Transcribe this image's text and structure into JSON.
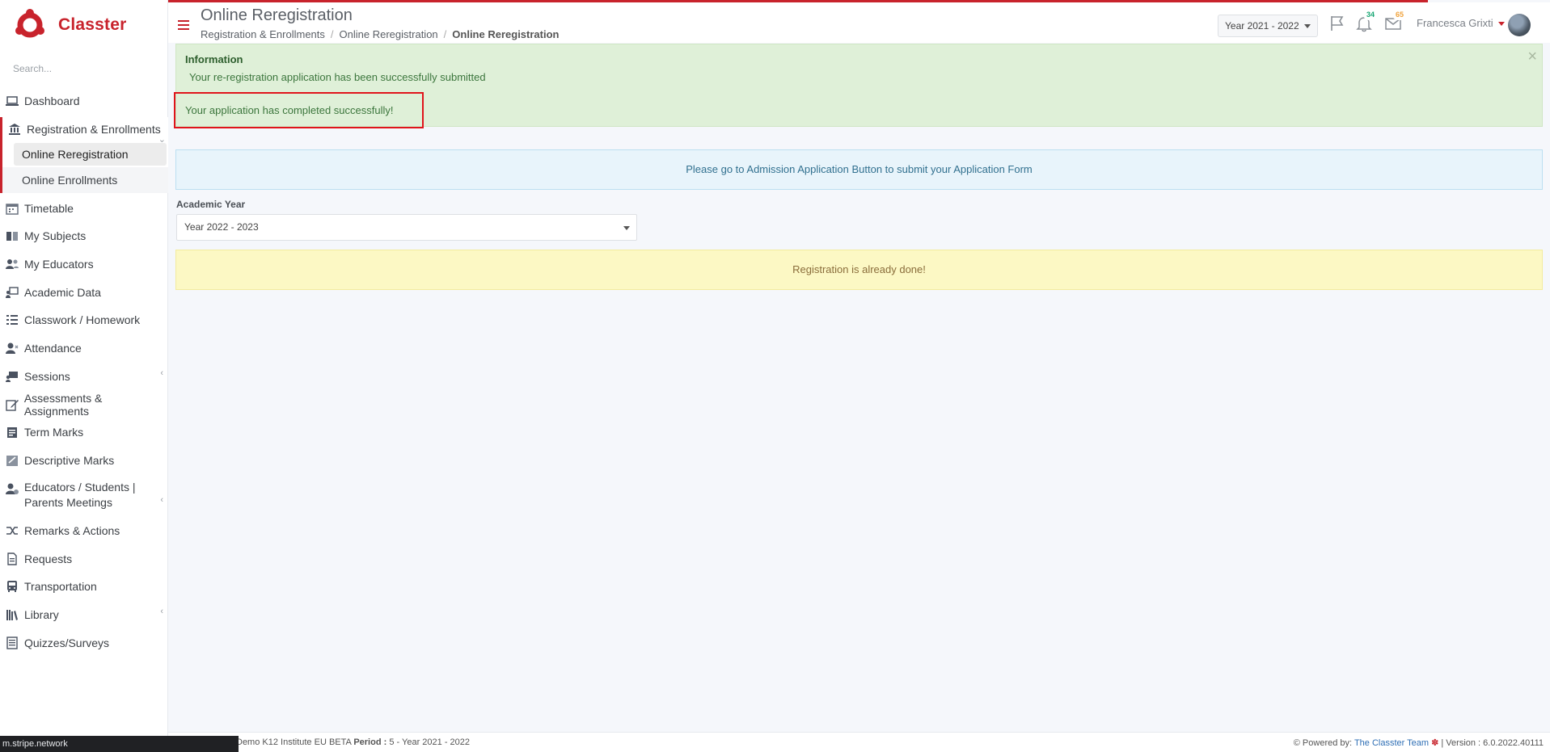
{
  "app": {
    "brand": "Classter",
    "brand_color": "#c8232c"
  },
  "sidebar": {
    "search_placeholder": "Search...",
    "items": [
      {
        "label": "Dashboard",
        "icon": "laptop-icon"
      },
      {
        "label": "Registration & Enrollments",
        "icon": "bank-icon"
      },
      {
        "label": "Timetable",
        "icon": "calendar-icon"
      },
      {
        "label": "My Subjects",
        "icon": "book-icon"
      },
      {
        "label": "My Educators",
        "icon": "users-icon"
      },
      {
        "label": "Academic Data",
        "icon": "presentation-icon"
      },
      {
        "label": "Classwork / Homework",
        "icon": "list-check-icon"
      },
      {
        "label": "Attendance",
        "icon": "user-x-icon"
      },
      {
        "label": "Sessions",
        "icon": "sessions-icon"
      },
      {
        "label": "Assessments & Assignments",
        "icon": "edit-icon"
      },
      {
        "label": "Term Marks",
        "icon": "term-marks-icon"
      },
      {
        "label": "Descriptive Marks",
        "icon": "descriptive-marks-icon"
      },
      {
        "label": "Educators / Students | Parents Meetings",
        "icon": "meeting-icon"
      },
      {
        "label": "Remarks & Actions",
        "icon": "shuffle-icon"
      },
      {
        "label": "Requests",
        "icon": "document-icon"
      },
      {
        "label": "Transportation",
        "icon": "bus-icon"
      },
      {
        "label": "Library",
        "icon": "library-icon"
      },
      {
        "label": "Quizzes/Surveys",
        "icon": "quiz-icon"
      }
    ],
    "sub_items": [
      {
        "label": "Online Reregistration"
      },
      {
        "label": "Online Enrollments"
      }
    ]
  },
  "header": {
    "title": "Online Reregistration",
    "breadcrumb": [
      "Registration & Enrollments",
      "Online Reregistration",
      "Online Reregistration"
    ],
    "year": "Year 2021 - 2022",
    "notifications_count": "34",
    "messages_count": "65",
    "user_name": "Francesca Grixti"
  },
  "main": {
    "info_title": "Information",
    "info_message": "Your re-registration application has been successfully submitted",
    "success_message": "Your application has completed successfully!",
    "admission_notice": "Please go to Admission Application Button to submit your Application Form",
    "academic_year_label": "Academic Year",
    "academic_year_value": "Year 2022 - 2023",
    "registration_notice": "Registration is already done!"
  },
  "footer": {
    "school_fragment": "Demo K12 Institute EU BETA",
    "period_label": "Period :",
    "period_value": "5 - Year 2021 - 2022",
    "powered_by": "Powered by:",
    "team": "The Classter Team",
    "version": "| Version : 6.0.2022.40111"
  },
  "browser_status": {
    "url": "m.stripe.network"
  }
}
